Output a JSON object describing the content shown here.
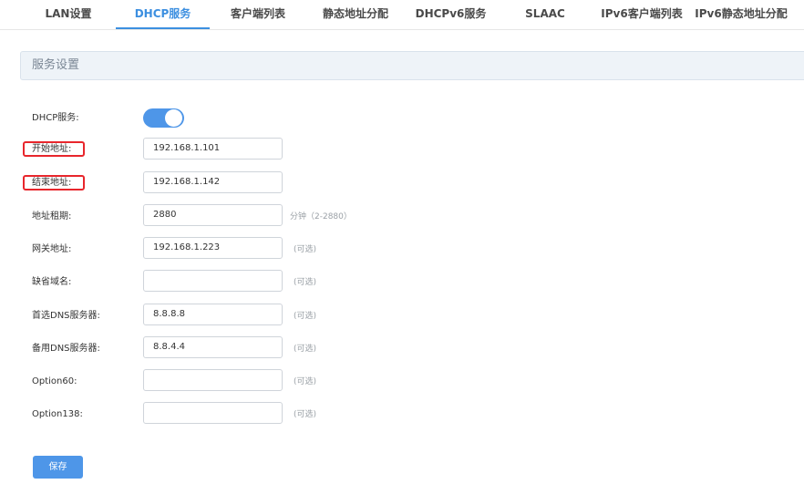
{
  "tabs": [
    {
      "label": "LAN设置"
    },
    {
      "label": "DHCP服务"
    },
    {
      "label": "客户端列表"
    },
    {
      "label": "静态地址分配"
    },
    {
      "label": "DHCPv6服务"
    },
    {
      "label": "SLAAC"
    },
    {
      "label": "IPv6客户端列表"
    },
    {
      "label": "IPv6静态地址分配"
    }
  ],
  "active_tab": "DHCP服务",
  "panel": {
    "title": "服务设置"
  },
  "form": {
    "dhcp_service": {
      "label": "DHCP服务:",
      "enabled": true
    },
    "start_address": {
      "label": "开始地址:",
      "value": "192.168.1.101"
    },
    "end_address": {
      "label": "结束地址:",
      "value": "192.168.1.142"
    },
    "lease_time": {
      "label": "地址租期:",
      "value": "2880",
      "hint": "分钟（2-2880）"
    },
    "gateway": {
      "label": "网关地址:",
      "value": "192.168.1.223",
      "hint": "(可选)"
    },
    "default_domain": {
      "label": "缺省域名:",
      "value": "",
      "hint": "(可选)"
    },
    "primary_dns": {
      "label": "首选DNS服务器:",
      "value": "8.8.8.8",
      "hint": "(可选)"
    },
    "secondary_dns": {
      "label": "备用DNS服务器:",
      "value": "8.8.4.4",
      "hint": "(可选)"
    },
    "option60": {
      "label": "Option60:",
      "value": "",
      "hint": "(可选)"
    },
    "option138": {
      "label": "Option138:",
      "value": "",
      "hint": "(可选)"
    }
  },
  "save_label": "保存",
  "colors": {
    "accent": "#3c8fe0",
    "highlight": "#e8262c"
  }
}
